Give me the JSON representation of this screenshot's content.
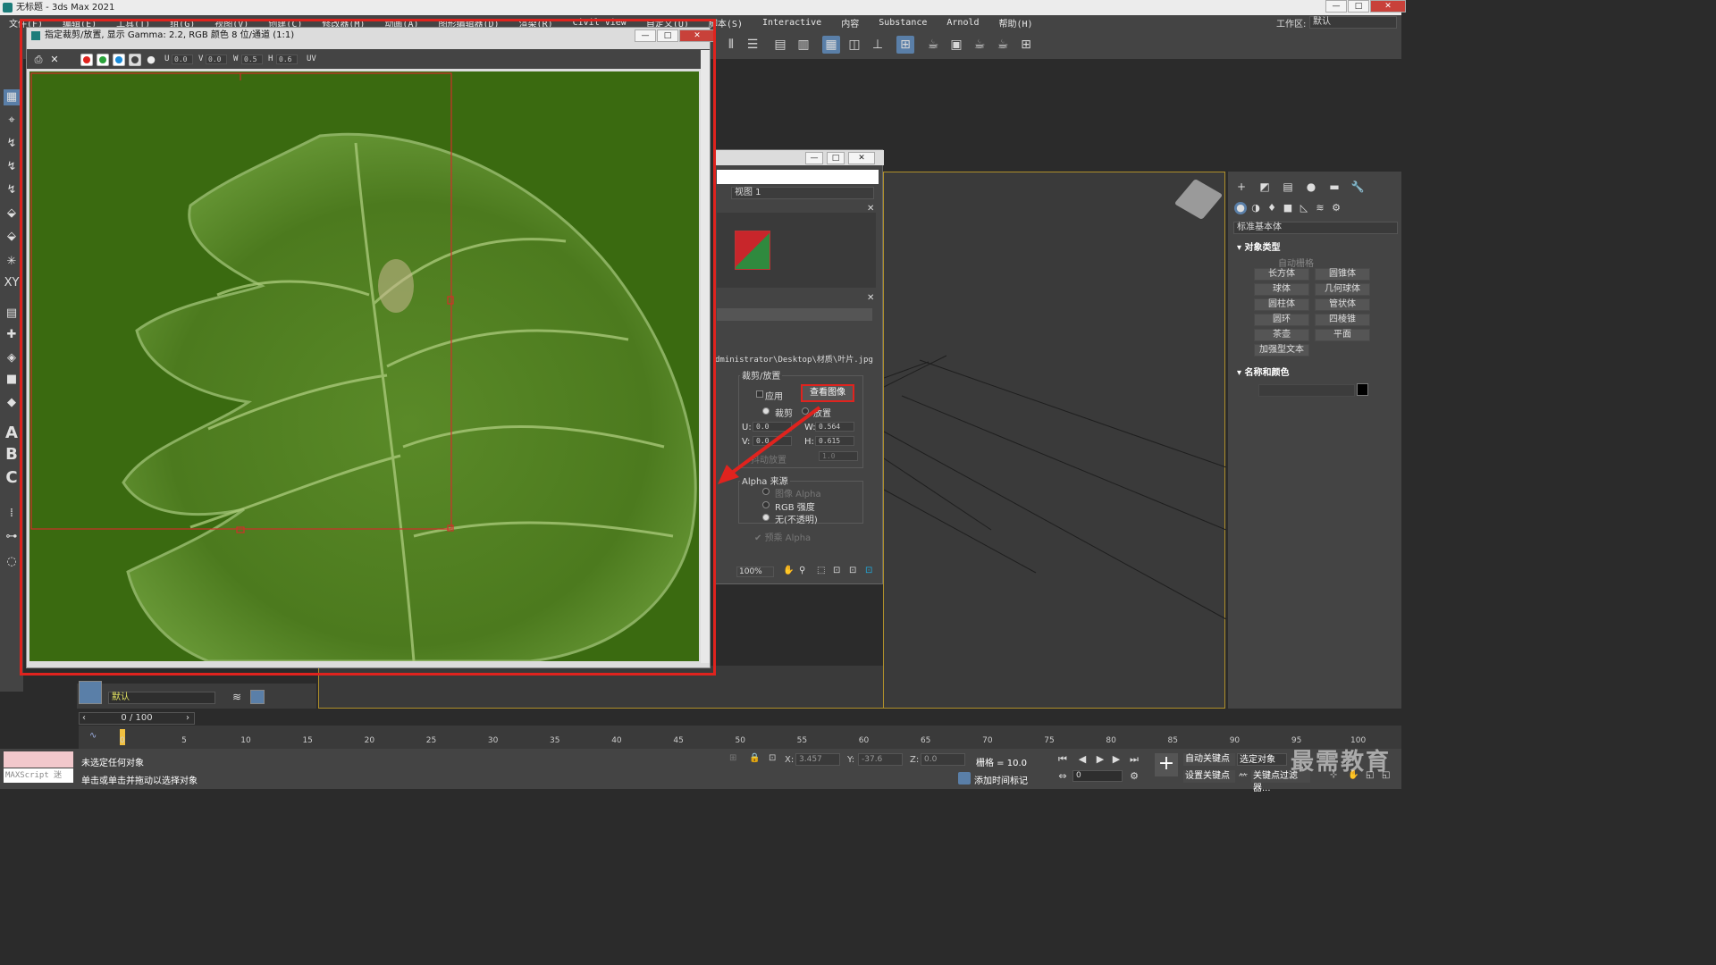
{
  "app": {
    "title": "无标题 - 3ds Max 2021",
    "window_buttons": [
      "—",
      "□",
      "✕"
    ]
  },
  "menu": [
    "文件(F)",
    "编辑(E)",
    "工具(T)",
    "组(G)",
    "视图(V)",
    "创建(C)",
    "修改器(M)",
    "动画(A)",
    "图形编辑器(D)",
    "渲染(R)",
    "Civil View",
    "自定义(U)",
    "脚本(S)",
    "Interactive",
    "内容",
    "Substance",
    "Arnold",
    "帮助(H)"
  ],
  "workspace": {
    "label": "工作区:",
    "value": "默认"
  },
  "frame_buffer": {
    "title": "指定裁剪/放置, 显示 Gamma: 2.2, RGB 颜色 8 位/通道 (1:1)",
    "fields": [
      {
        "label": "U",
        "value": "0.0"
      },
      {
        "label": "V",
        "value": "0.0"
      },
      {
        "label": "W",
        "value": "0.5"
      },
      {
        "label": "H",
        "value": "0.6"
      }
    ],
    "uv_label": "UV",
    "channel_colors": [
      "#e0231e",
      "#2aa33a",
      "#1a8ad8",
      "#ffffff"
    ],
    "highlight_color": "#e0231e"
  },
  "material_dialog": {
    "view_dropdown": "视图 1",
    "path": "dministrator\\Desktop\\材质\\叶片.jpg",
    "crop_group_label": "裁剪/放置",
    "apply_label": "应用",
    "view_image_button": "查看图像",
    "crop_radio": "裁剪",
    "place_radio": "放置",
    "u_label": "U:",
    "u_value": "0.0",
    "w_label": "W:",
    "w_value": "0.564",
    "v_label": "V:",
    "v_value": "0.0",
    "h_label": "H:",
    "h_value": "0.615",
    "jitter_label": "抖动放置",
    "jitter_value": "1.0",
    "alpha_group_label": "Alpha 来源",
    "alpha_options": [
      "图像 Alpha",
      "RGB 强度",
      "无(不透明)"
    ],
    "premult_label": "预乘 Alpha",
    "zoom": "100%"
  },
  "command_panel": {
    "dropdown": "标准基本体",
    "object_type_header": "对象类型",
    "autogrid": "自动栅格",
    "buttons": [
      "长方体",
      "圆锥体",
      "球体",
      "几何球体",
      "圆柱体",
      "管状体",
      "圆环",
      "四棱锥",
      "茶壶",
      "平面",
      "加强型文本"
    ],
    "name_color_header": "名称和颜色"
  },
  "layers": {
    "current": "默认"
  },
  "timeline": {
    "slider": "0 / 100",
    "ticks": [
      "0",
      "5",
      "10",
      "15",
      "20",
      "25",
      "30",
      "35",
      "40",
      "45",
      "50",
      "55",
      "60",
      "65",
      "70",
      "75",
      "80",
      "85",
      "90",
      "95",
      "100"
    ]
  },
  "status": {
    "maxscript": "MAXScript 迷",
    "line1": "未选定任何对象",
    "line2": "单击或单击并拖动以选择对象",
    "x_label": "X:",
    "x_value": "3.457",
    "y_label": "Y:",
    "y_value": "-37.6",
    "z_label": "Z:",
    "z_value": "0.0",
    "grid": "栅格 = 10.0",
    "add_time_tag": "添加时间标记",
    "auto_key": "自动关键点",
    "set_key": "设置关键点",
    "selected": "选定对象",
    "key_filters": "关键点过滤器...",
    "frame": "0"
  },
  "watermark": "最需教育"
}
